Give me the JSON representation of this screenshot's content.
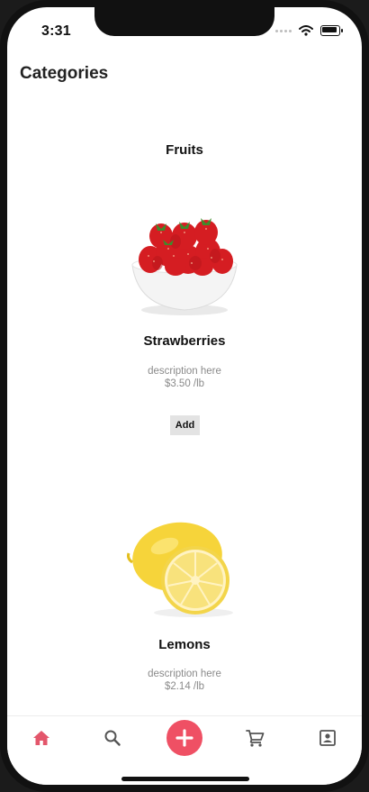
{
  "status": {
    "time": "3:31"
  },
  "header": {
    "title": "Categories"
  },
  "category": {
    "title": "Fruits"
  },
  "products": [
    {
      "name": "Strawberries",
      "description": "description here",
      "price": "$3.50 /lb",
      "add_label": "Add"
    },
    {
      "name": "Lemons",
      "description": "description here",
      "price": "$2.14 /lb"
    }
  ],
  "tabbar": {
    "items": [
      "home-icon",
      "search-icon",
      "add-icon",
      "cart-icon",
      "profile-icon"
    ],
    "active_color": "#e3566b",
    "inactive_color": "#555555",
    "accent": "#ef5064"
  }
}
